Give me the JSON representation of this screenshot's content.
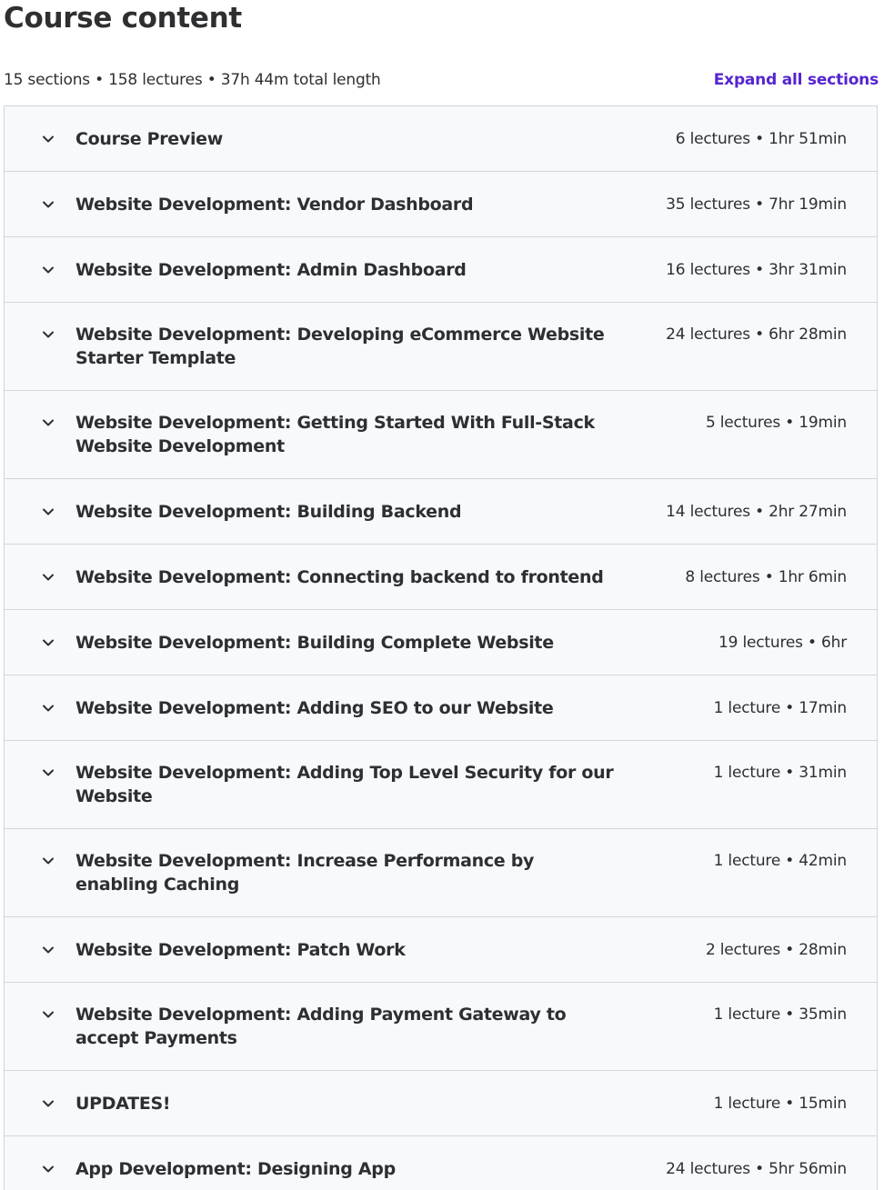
{
  "header": {
    "title": "Course content",
    "summary": "15 sections • 158 lectures • 37h 44m total length",
    "expand_label": "Expand all sections"
  },
  "icons": {
    "section_toggle": "chevron-down-icon"
  },
  "colors": {
    "accent": "#5624d0",
    "section_bg": "#f7f9fa",
    "border": "#d1d7dc",
    "text": "#2d2f31"
  },
  "sections": [
    {
      "title": "Course Preview",
      "meta": "6 lectures • 1hr 51min"
    },
    {
      "title": "Website Development: Vendor Dashboard",
      "meta": "35 lectures • 7hr 19min"
    },
    {
      "title": "Website Development: Admin Dashboard",
      "meta": "16 lectures • 3hr 31min"
    },
    {
      "title": "Website Development: Developing eCommerce Website Starter Template",
      "meta": "24 lectures • 6hr 28min"
    },
    {
      "title": "Website Development: Getting Started With Full-Stack Website Development",
      "meta": "5 lectures • 19min"
    },
    {
      "title": "Website Development: Building Backend",
      "meta": "14 lectures • 2hr 27min"
    },
    {
      "title": "Website Development: Connecting backend to frontend",
      "meta": "8 lectures • 1hr 6min"
    },
    {
      "title": "Website Development: Building Complete Website",
      "meta": "19 lectures • 6hr"
    },
    {
      "title": "Website Development: Adding SEO to our Website",
      "meta": "1 lecture • 17min"
    },
    {
      "title": "Website Development: Adding Top Level Security for our Website",
      "meta": "1 lecture • 31min"
    },
    {
      "title": "Website Development: Increase Performance by enabling Caching",
      "meta": "1 lecture • 42min"
    },
    {
      "title": "Website Development: Patch Work",
      "meta": "2 lectures • 28min"
    },
    {
      "title": "Website Development: Adding Payment Gateway to accept Payments",
      "meta": "1 lecture • 35min"
    },
    {
      "title": "UPDATES!",
      "meta": "1 lecture • 15min"
    },
    {
      "title": "App Development: Designing App",
      "meta": "24 lectures • 5hr 56min"
    }
  ]
}
